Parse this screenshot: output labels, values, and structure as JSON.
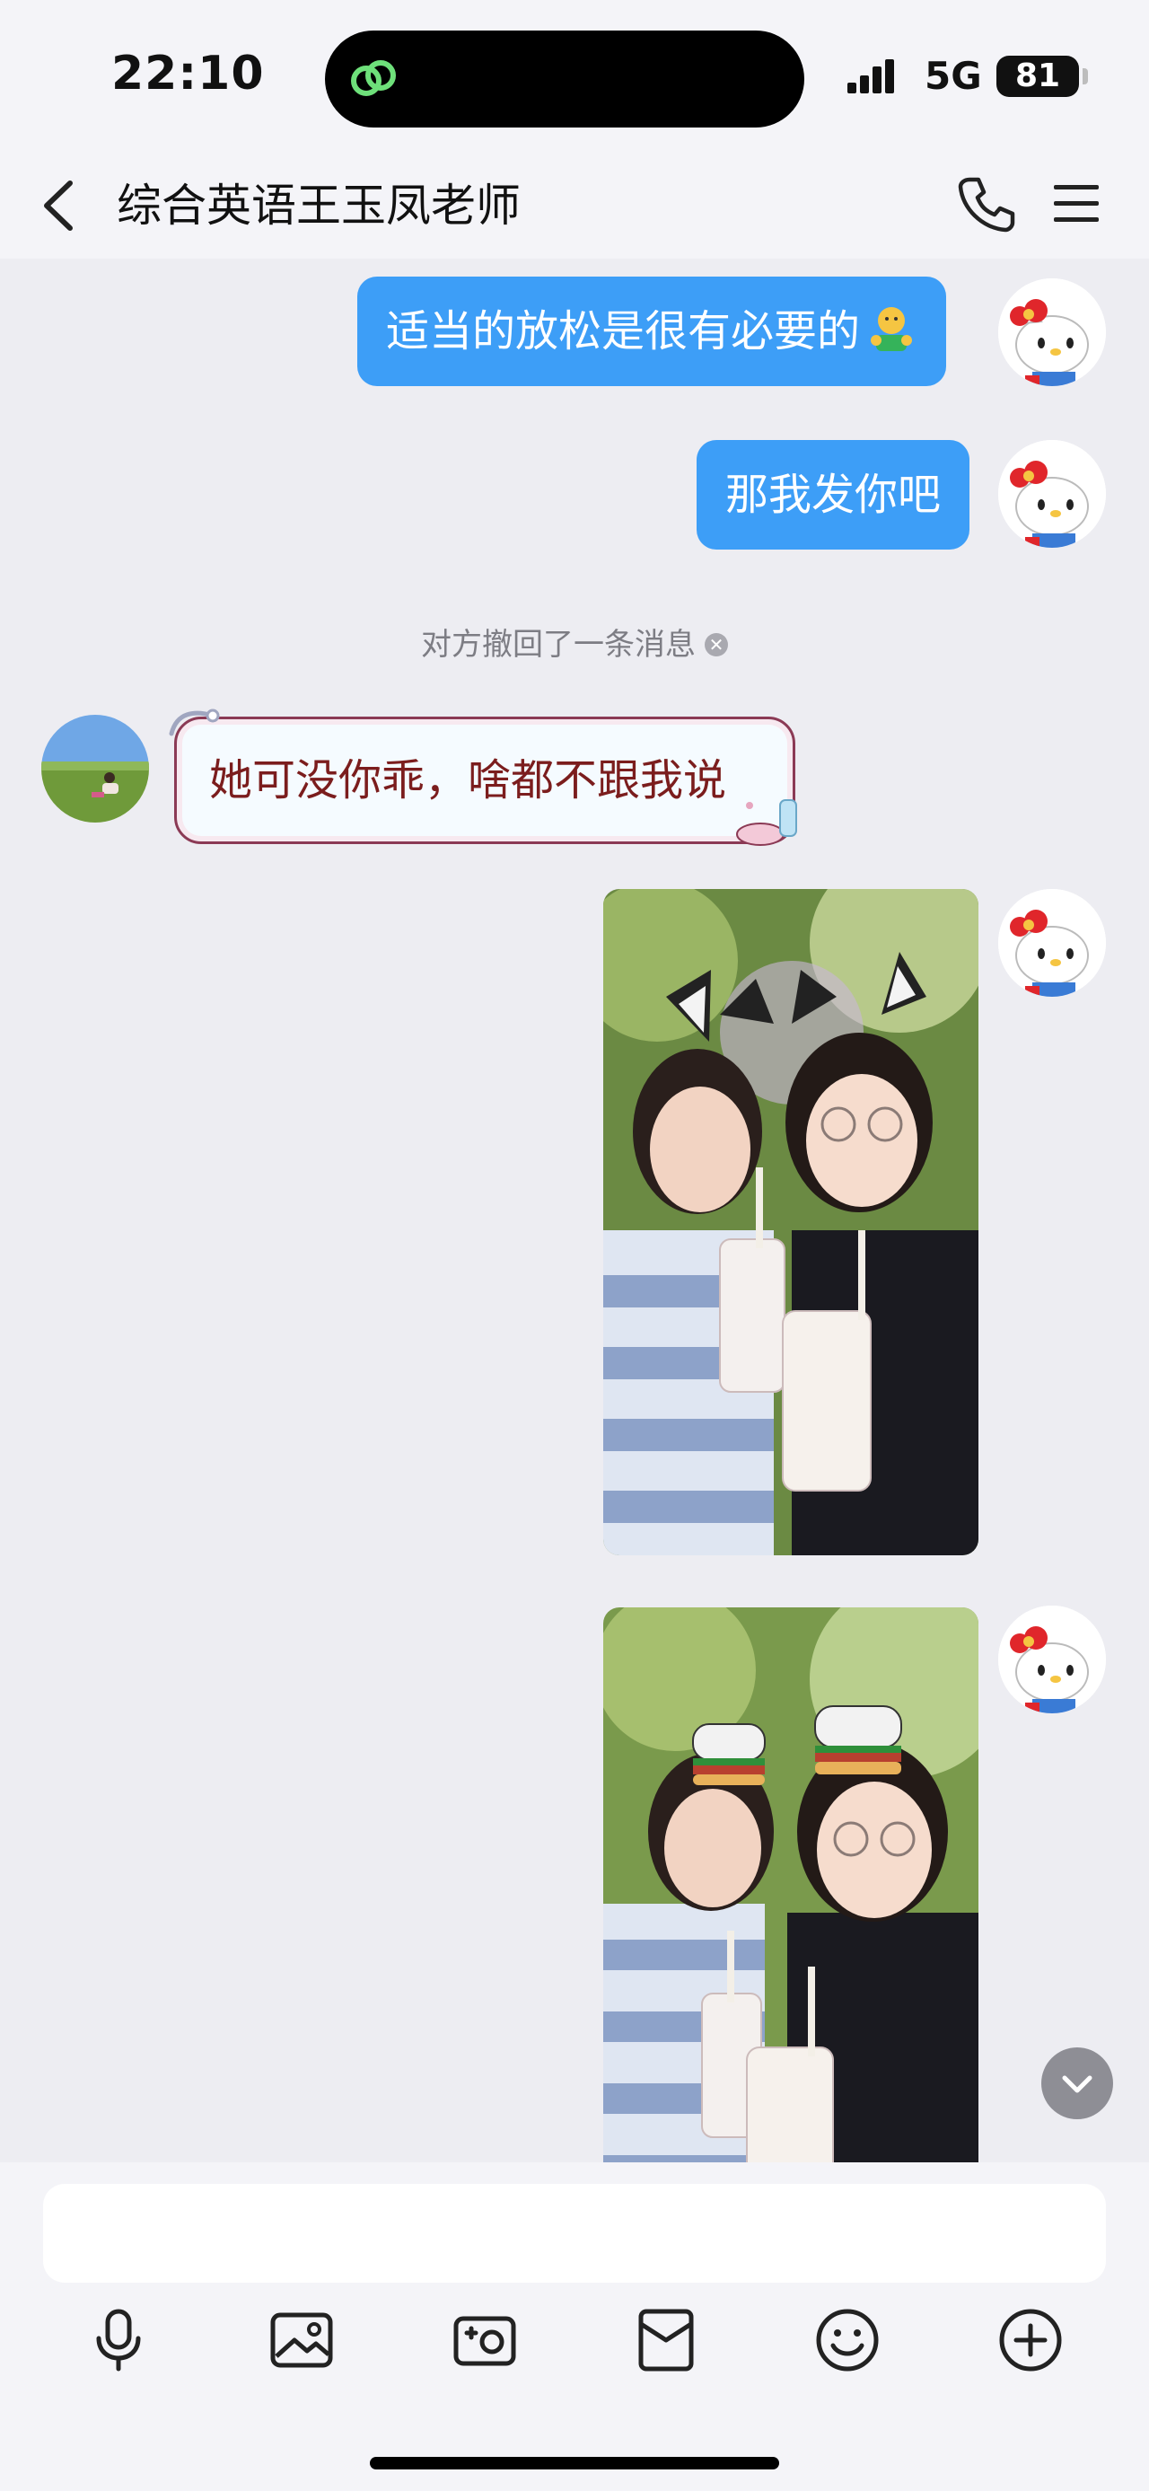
{
  "status_bar": {
    "time": "22:10",
    "network": "5G",
    "battery": "81"
  },
  "header": {
    "title": "综合英语王玉凤老师",
    "back_icon": "chevron-left-icon",
    "call_icon": "phone-icon",
    "menu_icon": "menu-icon"
  },
  "messages": {
    "m1": {
      "text": "适当的放松是很有必要的",
      "emoji": "person-hug-emoji"
    },
    "m2": {
      "text": "那我发你吧"
    },
    "recalled": {
      "text": "对方撤回了一条消息",
      "icon": "close-icon"
    },
    "m3": {
      "text": "她可没你乖，啥都不跟我说"
    }
  },
  "colors": {
    "accent": "#3d9ef7",
    "background": "#ededf2"
  },
  "toolbar": {
    "icons": [
      "microphone-icon",
      "image-icon",
      "camera-icon",
      "mailbox-icon",
      "emoji-icon",
      "plus-circle-icon"
    ]
  }
}
